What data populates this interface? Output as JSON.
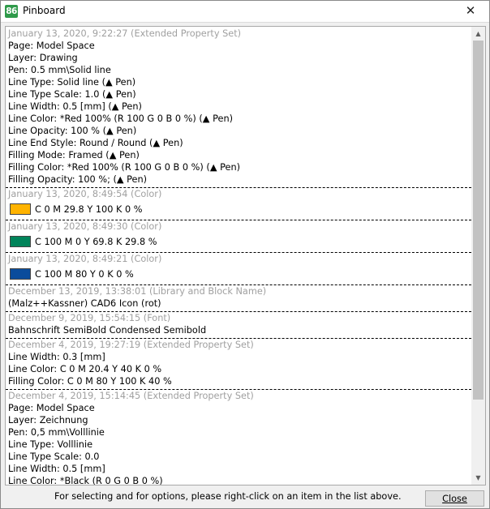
{
  "window": {
    "title": "Pinboard",
    "app_icon_text": "86",
    "close_glyph": "✕"
  },
  "entries": [
    {
      "header": "January 13, 2020, 9:22:27 (Extended Property Set)",
      "lines": [
        "Page:  Model Space",
        "Layer:  Drawing",
        "Pen:  0.5 mm\\Solid line",
        "Line Type:  Solid line (▲ Pen)",
        "Line Type Scale:  1.0 (▲ Pen)",
        "Line Width:  0.5 [mm] (▲ Pen)",
        "Line Color:  *Red 100% (R 100 G 0 B 0 %) (▲ Pen)",
        "Line Opacity:  100 % (▲ Pen)",
        "Line End Style:  Round / Round (▲ Pen)",
        "Filling Mode:  Framed (▲ Pen)",
        "Filling Color:  *Red 100% (R 100 G 0 B 0 %) (▲ Pen)",
        "Filling Opacity:  100 %;  (▲ Pen)"
      ]
    },
    {
      "header": "January 13, 2020, 8:49:54 (Color)",
      "color": "C 0 M 29.8 Y 100 K 0 %",
      "swatch": "#ffb300"
    },
    {
      "header": "January 13, 2020, 8:49:30 (Color)",
      "color": "C 100 M 0 Y 69.8 K 29.8 %",
      "swatch": "#00845a"
    },
    {
      "header": "January 13, 2020, 8:49:21 (Color)",
      "color": "C 100 M 80 Y 0 K 0 %",
      "swatch": "#0a4c9c"
    },
    {
      "header": "December 13, 2019, 13:38:01 (Library and Block Name)",
      "lines": [
        "(Malz++Kassner) CAD6 Icon (rot)"
      ]
    },
    {
      "header": "December 9, 2019, 15:54:15 (Font)",
      "lines": [
        "Bahnschrift SemiBold Condensed Semibold"
      ]
    },
    {
      "header": "December 4, 2019, 19:27:19 (Extended Property Set)",
      "lines": [
        "Line Width:  0.3 [mm]",
        "Line Color:  C 0 M 20.4 Y 40 K 0 %",
        "Filling Color:  C 0 M 80 Y 100 K 40 %"
      ]
    },
    {
      "header": "December 4, 2019, 15:14:45 (Extended Property Set)",
      "lines": [
        "Page:  Model Space",
        "Layer:  Zeichnung",
        "Pen:  0,5 mm\\Volllinie",
        "Line Type:  Volllinie",
        "Line Type Scale:  0.0",
        "Line Width:  0.5 [mm]",
        "Line Color:  *Black (R 0 G 0 B 0 %)"
      ]
    }
  ],
  "scrollbar": {
    "up_glyph": "▲",
    "down_glyph": "▼"
  },
  "status": {
    "hint": "For selecting and for options, please right-click on an item in the list above.",
    "close_label": "Close"
  }
}
